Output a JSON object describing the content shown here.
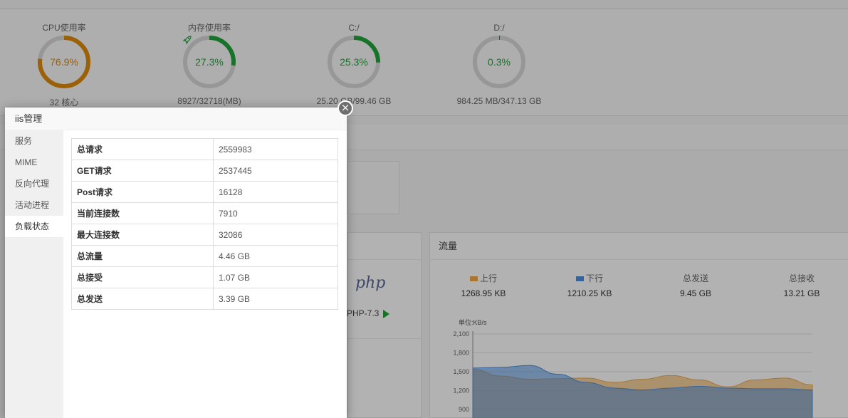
{
  "dashboard": {
    "gauges": [
      {
        "title": "CPU使用率",
        "value": "76.9%",
        "percent": 76.9,
        "sub": "32 核心",
        "color": "#e08a0b"
      },
      {
        "title": "内存使用率",
        "value": "27.3%",
        "percent": 27.3,
        "sub": "8927/32718(MB)",
        "color": "#20a53a",
        "icon": "rocket-icon"
      },
      {
        "title": "C:/",
        "value": "25.3%",
        "percent": 25.3,
        "sub": "25.20 GB/99.46 GB",
        "color": "#20a53a"
      },
      {
        "title": "D:/",
        "value": "0.3%",
        "percent": 0.3,
        "sub": "984.25 MB/347.13 GB",
        "color": "#20a53a"
      }
    ],
    "software": {
      "logo": "php",
      "version": "PHP-7.3"
    },
    "traffic": {
      "title": "流量",
      "stats": [
        {
          "label": "上行",
          "value": "1268.95 KB",
          "swatch": "#f0a94a"
        },
        {
          "label": "下行",
          "value": "1210.25 KB",
          "swatch": "#4a90e2"
        },
        {
          "label": "总发送",
          "value": "9.45 GB"
        },
        {
          "label": "总接收",
          "value": "13.21 GB"
        }
      ]
    }
  },
  "chart_data": {
    "type": "area",
    "unit_label": "单位:KB/s",
    "yticks": [
      "2,100",
      "1,800",
      "1,500",
      "1,200",
      "900"
    ],
    "ylim": [
      900,
      2100
    ],
    "x": [
      0,
      1,
      2,
      3,
      4,
      5,
      6,
      7,
      8,
      9,
      10,
      11,
      12
    ],
    "series": [
      {
        "name": "上行",
        "color": "#f0a94a",
        "values": [
          1540,
          1430,
          1380,
          1390,
          1400,
          1330,
          1380,
          1440,
          1370,
          1260,
          1370,
          1400,
          1290
        ]
      },
      {
        "name": "下行",
        "color": "#4a90e2",
        "values": [
          1560,
          1570,
          1600,
          1460,
          1330,
          1240,
          1210,
          1240,
          1270,
          1240,
          1230,
          1230,
          1210
        ]
      }
    ]
  },
  "modal": {
    "title": "iis管理",
    "close_label": "×",
    "nav": [
      "服务",
      "MIME",
      "反向代理",
      "活动进程",
      "负载状态"
    ],
    "active_index": 4,
    "rows": [
      [
        "总请求",
        "2559983"
      ],
      [
        "GET请求",
        "2537445"
      ],
      [
        "Post请求",
        "16128"
      ],
      [
        "当前连接数",
        "7910"
      ],
      [
        "最大连接数",
        "32086"
      ],
      [
        "总流量",
        "4.46 GB"
      ],
      [
        "总接受",
        "1.07 GB"
      ],
      [
        "总发送",
        "3.39 GB"
      ]
    ]
  },
  "colors": {
    "accent_green": "#20a53a",
    "cpu_orange": "#e08a0b",
    "ring_track": "#d9d9d9"
  }
}
